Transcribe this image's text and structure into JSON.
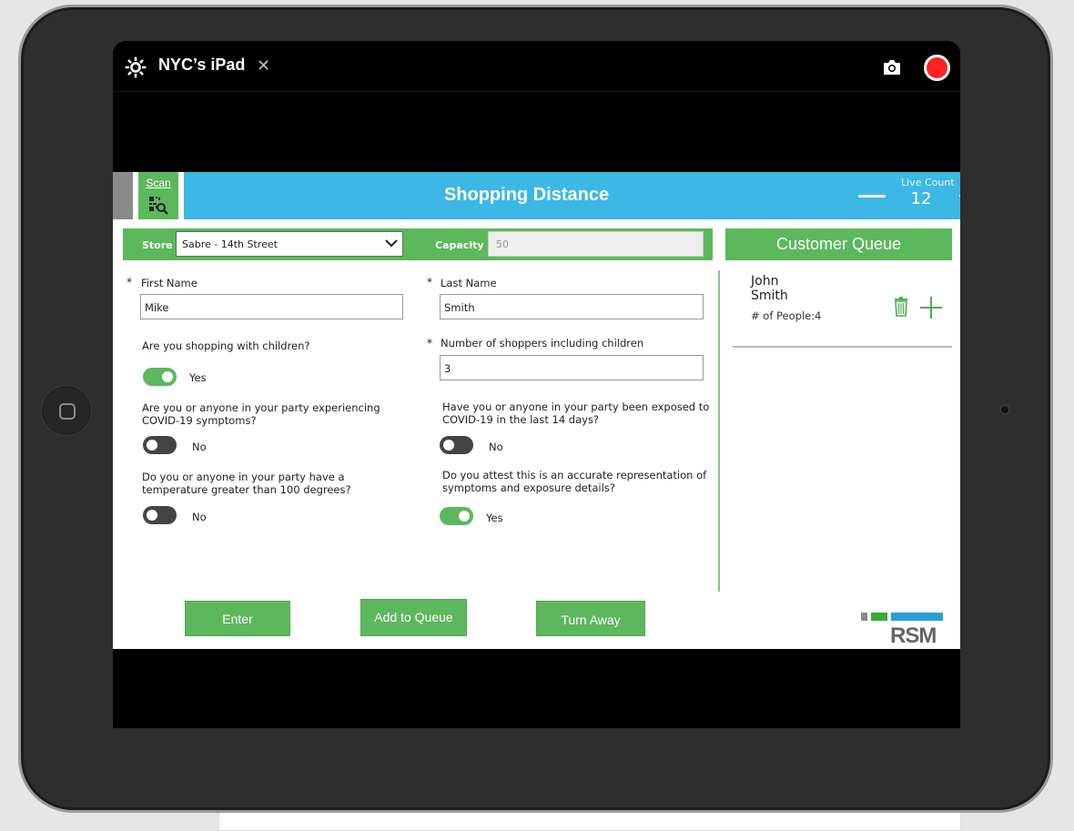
{
  "device": {
    "name": "NYC’s iPad"
  },
  "header": {
    "scan_label": "Scan",
    "title": "Shopping Distance",
    "live_count_label": "Live Count",
    "live_count_value": "12"
  },
  "store_bar": {
    "store_label": "Store",
    "store_value": "Sabre - 14th Street",
    "capacity_label": "Capacity",
    "capacity_value": "50"
  },
  "form": {
    "required_mark": "*",
    "first_name_label": "First Name",
    "first_name_value": "Mike",
    "last_name_label": "Last Name",
    "last_name_value": "Smith",
    "children_question": "Are you shopping with children?",
    "children_answer": "Yes",
    "shoppers_label": "Number of shoppers including children",
    "shoppers_value": "3",
    "symptoms_question_1": "Are you or anyone in your party experiencing",
    "symptoms_question_2": "COVID-19 symptoms?",
    "symptoms_answer": "No",
    "exposed_question_1": "Have you or anyone in your party been exposed to",
    "exposed_question_2": "COVID-19 in the last 14 days?",
    "exposed_answer": "No",
    "temp_question_1": "Do you or anyone in your party have a",
    "temp_question_2": "temperature greater than 100 degrees?",
    "temp_answer": "No",
    "attest_question_1": "Do you attest this is an accurate representation of",
    "attest_question_2": "symptoms and exposure details?",
    "attest_answer": "Yes"
  },
  "queue": {
    "title": "Customer Queue",
    "entries": [
      {
        "first_name": "John",
        "last_name": "Smith",
        "people_label": "# of People:",
        "people_value": "4"
      }
    ]
  },
  "actions": {
    "enter": "Enter",
    "add_to_queue": "Add to Queue",
    "turn_away": "Turn Away"
  },
  "brand": {
    "logo_text": "RSM"
  },
  "colors": {
    "accent_green": "#5cb85c",
    "header_blue": "#3db7e4",
    "record_red": "#ff2222"
  }
}
